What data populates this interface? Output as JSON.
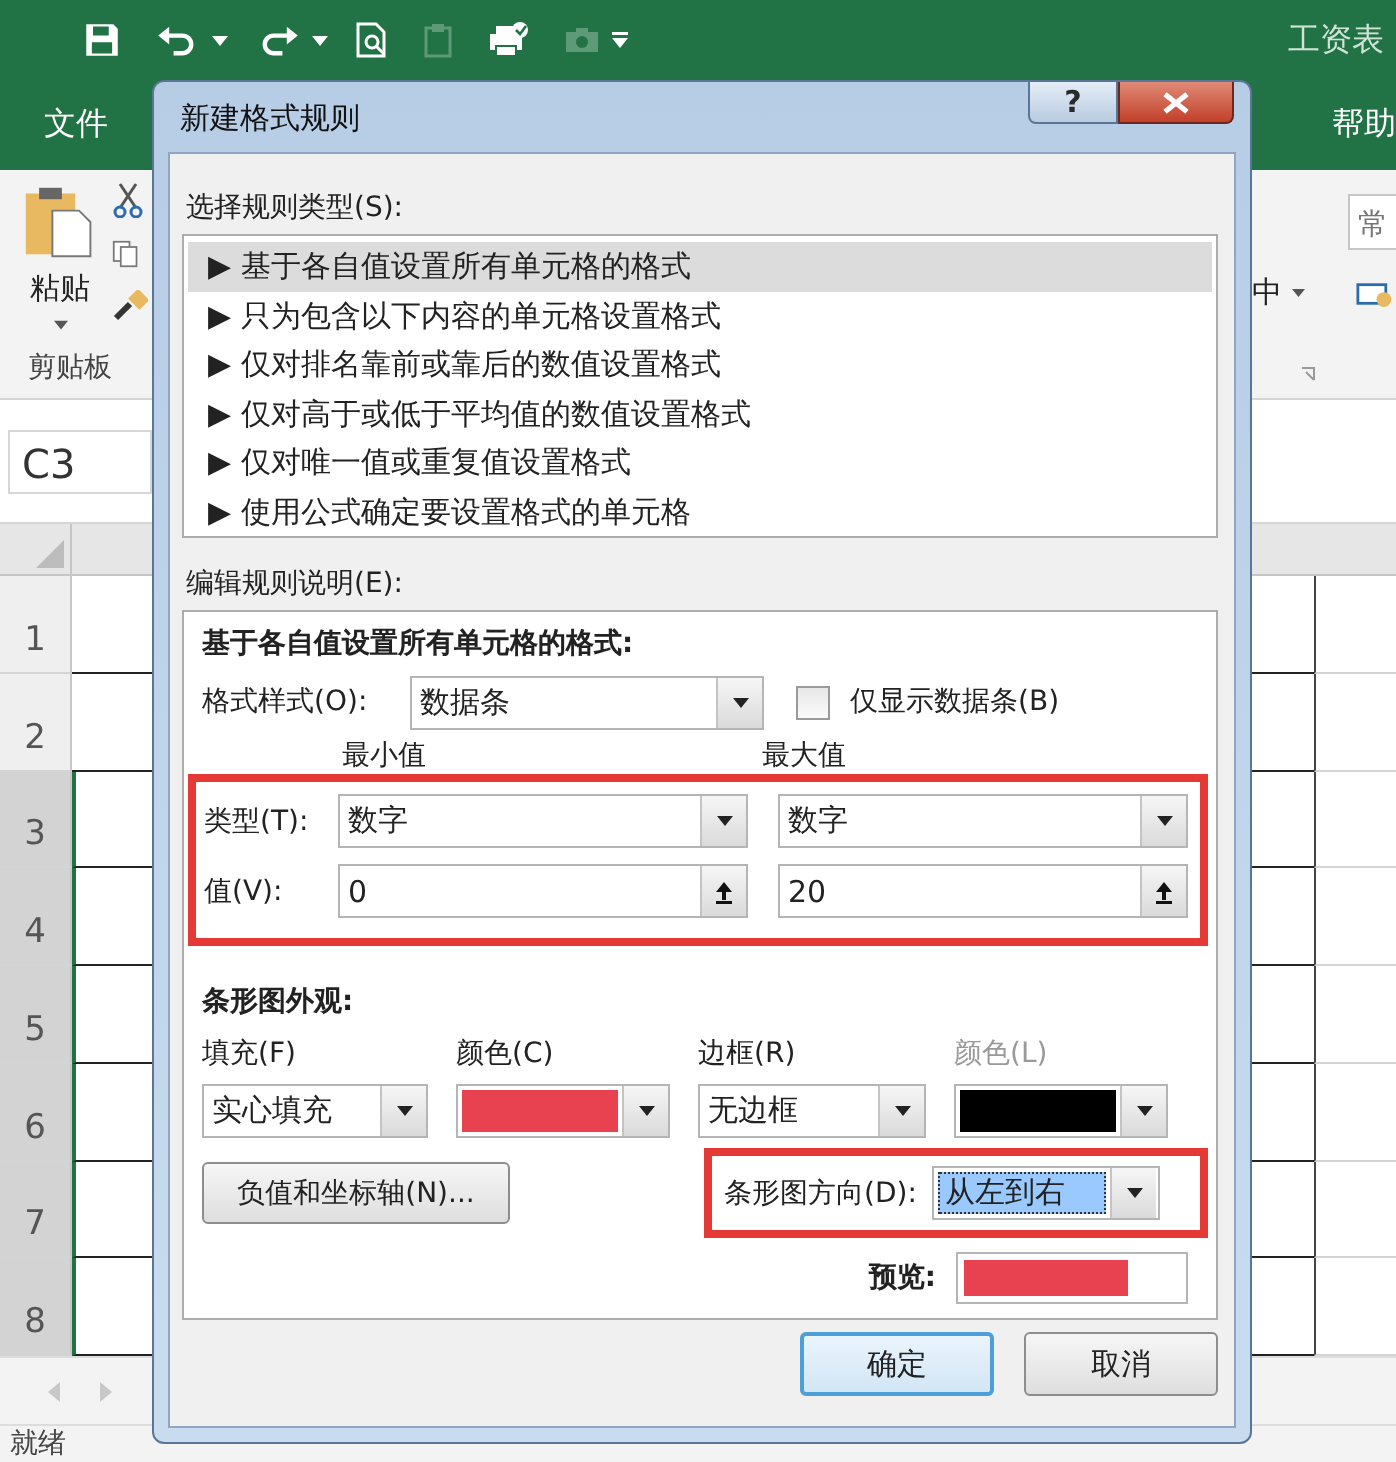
{
  "app": {
    "document_title": "工资表",
    "menu_tabs": [
      {
        "label": "文件"
      },
      {
        "label": "帮助"
      }
    ],
    "ribbon": {
      "paste_label": "粘贴",
      "clipboard_group": "剪贴板",
      "number_format": "常",
      "align_label": "中"
    },
    "name_box": "C3",
    "row_headers": [
      {
        "label": "1",
        "selected": false
      },
      {
        "label": "2",
        "selected": false
      },
      {
        "label": "3",
        "selected": true
      },
      {
        "label": "4",
        "selected": true
      },
      {
        "label": "5",
        "selected": true
      },
      {
        "label": "6",
        "selected": true
      },
      {
        "label": "7",
        "selected": true
      },
      {
        "label": "8",
        "selected": true
      }
    ],
    "status": "就绪"
  },
  "dialog": {
    "title": "新建格式规则",
    "help_button": "?",
    "rule_type_label": "选择规则类型(S):",
    "rule_types": [
      {
        "label": "▶ 基于各自值设置所有单元格的格式",
        "selected": true
      },
      {
        "label": "▶ 只为包含以下内容的单元格设置格式",
        "selected": false
      },
      {
        "label": "▶ 仅对排名靠前或靠后的数值设置格式",
        "selected": false
      },
      {
        "label": "▶ 仅对高于或低于平均值的数值设置格式",
        "selected": false
      },
      {
        "label": "▶ 仅对唯一值或重复值设置格式",
        "selected": false
      },
      {
        "label": "▶ 使用公式确定要设置格式的单元格",
        "selected": false
      }
    ],
    "description_label": "编辑规则说明(E):",
    "description": {
      "heading": "基于各自值设置所有单元格的格式:",
      "format_style": {
        "label": "格式样式(O):",
        "value": "数据条"
      },
      "bars_only": {
        "label": "仅显示数据条(B)",
        "checked": false
      },
      "min_heading": "最小值",
      "max_heading": "最大值",
      "type_label": "类型(T):",
      "min_type": "数字",
      "max_type": "数字",
      "value_label": "值(V):",
      "min_value": "0",
      "max_value": "20",
      "appearance_heading": "条形图外观:",
      "fill": {
        "label": "填充(F)",
        "value": "实心填充"
      },
      "fill_color": {
        "label": "颜色(C)",
        "color": "#e8414f"
      },
      "border": {
        "label": "边框(R)",
        "value": "无边框"
      },
      "border_color": {
        "label": "颜色(L)",
        "color": "#000000",
        "disabled": true
      },
      "axis_button": "负值和坐标轴(N)...",
      "direction": {
        "label": "条形图方向(D):",
        "value": "从左到右"
      },
      "preview_label": "预览:"
    },
    "buttons": [
      {
        "label": "确定",
        "default": true
      },
      {
        "label": "取消",
        "default": false
      }
    ]
  }
}
